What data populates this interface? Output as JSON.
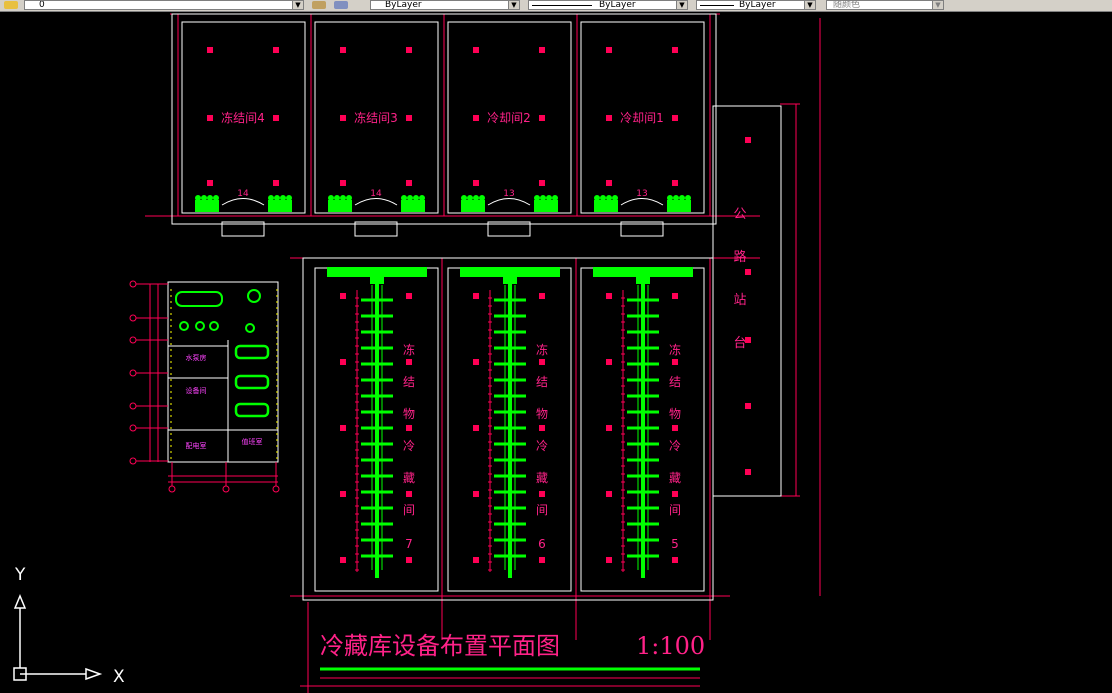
{
  "toolbar": {
    "layer_value": "0",
    "color_value": "ByLayer",
    "linetype_value": "ByLayer",
    "lineweight_value": "ByLayer",
    "plotstyle_value": "随颜色"
  },
  "drawing": {
    "title": "冷藏库设备布置平面图",
    "scale": "1:100",
    "rooms_top": [
      {
        "label": "冻结间4",
        "count": "14"
      },
      {
        "label": "冻结间3",
        "count": "14"
      },
      {
        "label": "冷却间2",
        "count": "13"
      },
      {
        "label": "冷却间1",
        "count": "13"
      }
    ],
    "rooms_cold": [
      {
        "chars": [
          "冻",
          "结",
          "物",
          "冷",
          "藏",
          "间",
          "7"
        ]
      },
      {
        "chars": [
          "冻",
          "结",
          "物",
          "冷",
          "藏",
          "间",
          "6"
        ]
      },
      {
        "chars": [
          "冻",
          "结",
          "物",
          "冷",
          "藏",
          "间",
          "5"
        ]
      }
    ],
    "platform_chars": [
      "公",
      "路",
      "站",
      "台"
    ],
    "machine_room": {
      "labels": [
        "水泵房",
        "设备间",
        "配电室",
        "值班室"
      ]
    }
  },
  "ucs": {
    "y_label": "Y",
    "x_label": "X"
  },
  "colors": {
    "background": "#000000",
    "wall": "#ffffff",
    "dim_line": "#ff0055",
    "equipment": "#00ff00",
    "label": "#ff2288",
    "machine_label": "#ff44ff"
  }
}
